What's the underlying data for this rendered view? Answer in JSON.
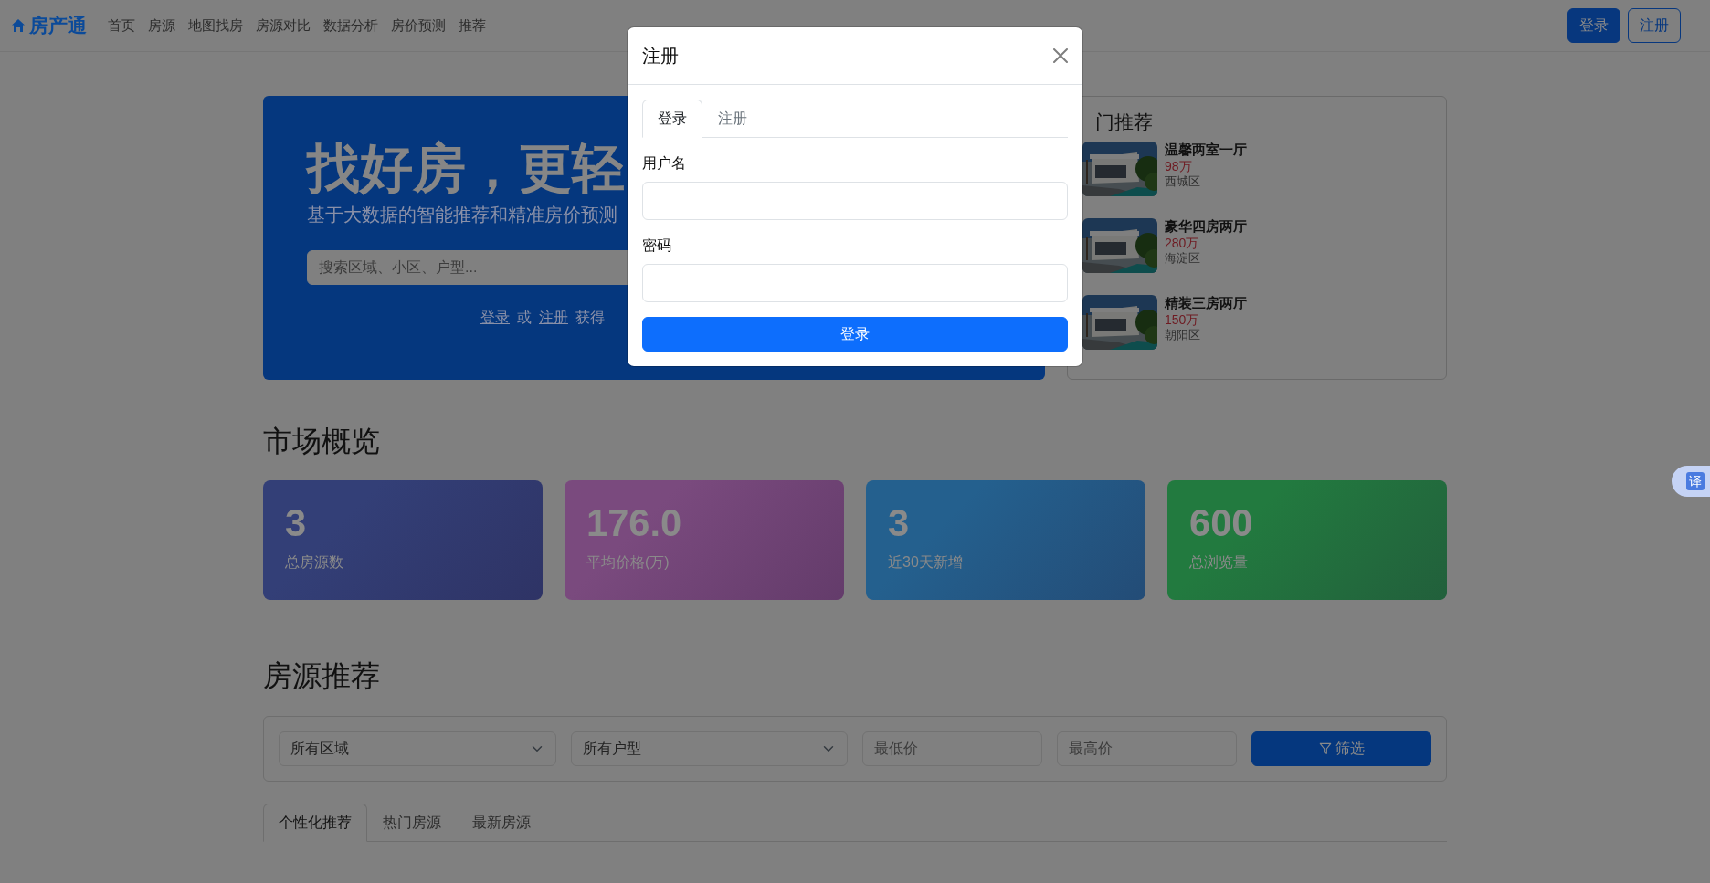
{
  "navbar": {
    "brand": "房产通",
    "links": [
      "首页",
      "房源",
      "地图找房",
      "房源对比",
      "数据分析",
      "房价预测",
      "推荐"
    ],
    "auth_buttons": [
      {
        "label": "登录",
        "kind": "solid"
      },
      {
        "label": "注册",
        "kind": "outline"
      }
    ]
  },
  "hero": {
    "title": "找好房，更轻",
    "subtitle": "基于大数据的智能推荐和精准房价预测",
    "search": {
      "placeholder": "搜索区域、小区、户型..."
    },
    "prompt": [
      {
        "kind": "link",
        "text": "登录"
      },
      {
        "kind": "text",
        "text": "或"
      },
      {
        "kind": "link",
        "text": "注册"
      },
      {
        "kind": "text",
        "text": "获得"
      }
    ]
  },
  "hot": {
    "title": "门推荐",
    "items": [
      {
        "title": "温馨两室一厅",
        "price": "98万",
        "district": "西城区"
      },
      {
        "title": "豪华四房两厅",
        "price": "280万",
        "district": "海淀区"
      },
      {
        "title": "精装三房两厅",
        "price": "150万",
        "district": "朝阳区"
      }
    ]
  },
  "market": {
    "heading": "市场概览",
    "stats": [
      {
        "value": "3",
        "label": "总房源数",
        "color": "#333f77"
      },
      {
        "value": "176.0",
        "label": "平均价格(万)",
        "color": "#7a4a7e"
      },
      {
        "value": "3",
        "label": "近30天新增",
        "color": "#24608e"
      },
      {
        "value": "600",
        "label": "总浏览量",
        "color": "#227a3f"
      }
    ]
  },
  "listings": {
    "heading": "房源推荐",
    "filters": {
      "selects": [
        "所有区域",
        "所有户型"
      ],
      "inputs": [
        {
          "placeholder": "最低价"
        },
        {
          "placeholder": "最高价"
        }
      ],
      "button": "筛选"
    },
    "tabs": [
      {
        "label": "个性化推荐",
        "selected": true
      },
      {
        "label": "热门房源",
        "selected": false
      },
      {
        "label": "最新房源",
        "selected": false
      }
    ]
  },
  "modal": {
    "title": "注册",
    "tabs": [
      {
        "label": "登录",
        "selected": true
      },
      {
        "label": "注册",
        "selected": false
      }
    ],
    "fields": [
      {
        "label": "用户名"
      },
      {
        "label": "密码"
      }
    ],
    "submit": "登录"
  },
  "translate": "译"
}
